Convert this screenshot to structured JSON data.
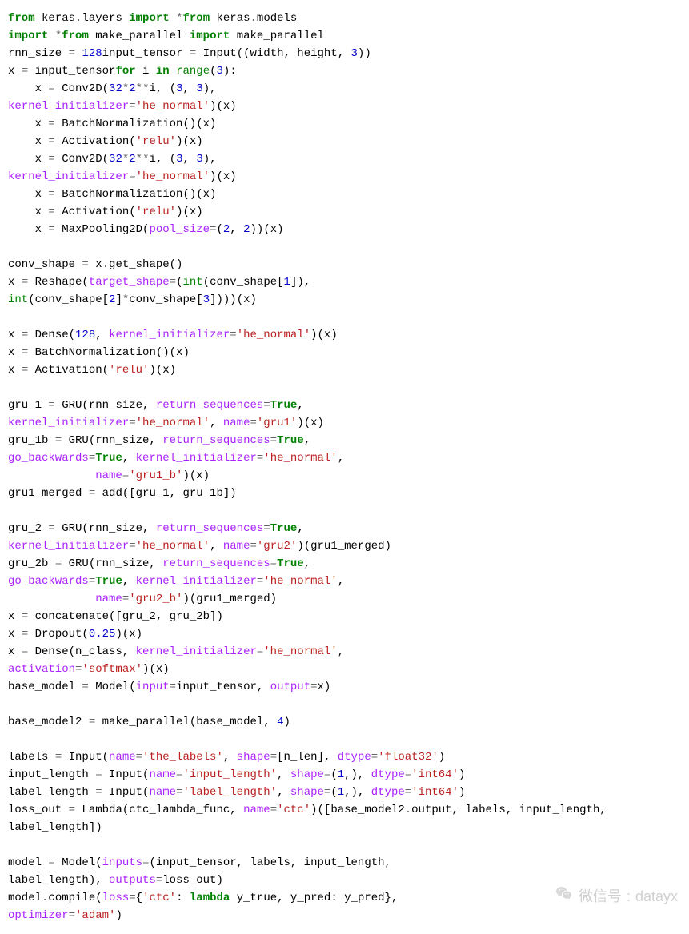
{
  "lines": [
    [
      {
        "t": "from",
        "c": "kw"
      },
      {
        "t": " keras",
        "c": "nm"
      },
      {
        "t": ".",
        "c": "op"
      },
      {
        "t": "layers ",
        "c": "nm"
      },
      {
        "t": "import",
        "c": "kw"
      },
      {
        "t": " ",
        "c": "nm"
      },
      {
        "t": "*",
        "c": "op"
      },
      {
        "t": "from",
        "c": "kw"
      },
      {
        "t": " keras",
        "c": "nm"
      },
      {
        "t": ".",
        "c": "op"
      },
      {
        "t": "models",
        "c": "nm"
      }
    ],
    [
      {
        "t": "import",
        "c": "kw"
      },
      {
        "t": " ",
        "c": "nm"
      },
      {
        "t": "*",
        "c": "op"
      },
      {
        "t": "from",
        "c": "kw"
      },
      {
        "t": " make_parallel ",
        "c": "nm"
      },
      {
        "t": "import",
        "c": "kw"
      },
      {
        "t": " make_parallel",
        "c": "nm"
      }
    ],
    [
      {
        "t": "rnn_size ",
        "c": "nm"
      },
      {
        "t": "=",
        "c": "op"
      },
      {
        "t": " ",
        "c": "nm"
      },
      {
        "t": "128",
        "c": "num"
      },
      {
        "t": "input_tensor ",
        "c": "nm"
      },
      {
        "t": "=",
        "c": "op"
      },
      {
        "t": " Input((width, height, ",
        "c": "nm"
      },
      {
        "t": "3",
        "c": "num"
      },
      {
        "t": "))",
        "c": "nm"
      }
    ],
    [
      {
        "t": "x ",
        "c": "nm"
      },
      {
        "t": "=",
        "c": "op"
      },
      {
        "t": " input_tensor",
        "c": "nm"
      },
      {
        "t": "for",
        "c": "kw"
      },
      {
        "t": " i ",
        "c": "nm"
      },
      {
        "t": "in",
        "c": "kw"
      },
      {
        "t": " ",
        "c": "nm"
      },
      {
        "t": "range",
        "c": "bi"
      },
      {
        "t": "(",
        "c": "nm"
      },
      {
        "t": "3",
        "c": "num"
      },
      {
        "t": "):",
        "c": "nm"
      }
    ],
    [
      {
        "t": "    x ",
        "c": "nm"
      },
      {
        "t": "=",
        "c": "op"
      },
      {
        "t": " Conv2D(",
        "c": "nm"
      },
      {
        "t": "32",
        "c": "num"
      },
      {
        "t": "*",
        "c": "op"
      },
      {
        "t": "2",
        "c": "num"
      },
      {
        "t": "**",
        "c": "op"
      },
      {
        "t": "i, (",
        "c": "nm"
      },
      {
        "t": "3",
        "c": "num"
      },
      {
        "t": ", ",
        "c": "nm"
      },
      {
        "t": "3",
        "c": "num"
      },
      {
        "t": "),",
        "c": "nm"
      }
    ],
    [
      {
        "t": "kernel_initializer",
        "c": "name"
      },
      {
        "t": "=",
        "c": "op"
      },
      {
        "t": "'he_normal'",
        "c": "str"
      },
      {
        "t": ")(x)",
        "c": "nm"
      }
    ],
    [
      {
        "t": "    x ",
        "c": "nm"
      },
      {
        "t": "=",
        "c": "op"
      },
      {
        "t": " BatchNormalization()(x)",
        "c": "nm"
      }
    ],
    [
      {
        "t": "    x ",
        "c": "nm"
      },
      {
        "t": "=",
        "c": "op"
      },
      {
        "t": " Activation(",
        "c": "nm"
      },
      {
        "t": "'relu'",
        "c": "str"
      },
      {
        "t": ")(x)",
        "c": "nm"
      }
    ],
    [
      {
        "t": "    x ",
        "c": "nm"
      },
      {
        "t": "=",
        "c": "op"
      },
      {
        "t": " Conv2D(",
        "c": "nm"
      },
      {
        "t": "32",
        "c": "num"
      },
      {
        "t": "*",
        "c": "op"
      },
      {
        "t": "2",
        "c": "num"
      },
      {
        "t": "**",
        "c": "op"
      },
      {
        "t": "i, (",
        "c": "nm"
      },
      {
        "t": "3",
        "c": "num"
      },
      {
        "t": ", ",
        "c": "nm"
      },
      {
        "t": "3",
        "c": "num"
      },
      {
        "t": "),",
        "c": "nm"
      }
    ],
    [
      {
        "t": "kernel_initializer",
        "c": "name"
      },
      {
        "t": "=",
        "c": "op"
      },
      {
        "t": "'he_normal'",
        "c": "str"
      },
      {
        "t": ")(x)",
        "c": "nm"
      }
    ],
    [
      {
        "t": "    x ",
        "c": "nm"
      },
      {
        "t": "=",
        "c": "op"
      },
      {
        "t": " BatchNormalization()(x)",
        "c": "nm"
      }
    ],
    [
      {
        "t": "    x ",
        "c": "nm"
      },
      {
        "t": "=",
        "c": "op"
      },
      {
        "t": " Activation(",
        "c": "nm"
      },
      {
        "t": "'relu'",
        "c": "str"
      },
      {
        "t": ")(x)",
        "c": "nm"
      }
    ],
    [
      {
        "t": "    x ",
        "c": "nm"
      },
      {
        "t": "=",
        "c": "op"
      },
      {
        "t": " MaxPooling2D(",
        "c": "nm"
      },
      {
        "t": "pool_size",
        "c": "name"
      },
      {
        "t": "=",
        "c": "op"
      },
      {
        "t": "(",
        "c": "nm"
      },
      {
        "t": "2",
        "c": "num"
      },
      {
        "t": ", ",
        "c": "nm"
      },
      {
        "t": "2",
        "c": "num"
      },
      {
        "t": "))(x)",
        "c": "nm"
      }
    ],
    [
      {
        "t": "",
        "c": "nm"
      }
    ],
    [
      {
        "t": "conv_shape ",
        "c": "nm"
      },
      {
        "t": "=",
        "c": "op"
      },
      {
        "t": " x",
        "c": "nm"
      },
      {
        "t": ".",
        "c": "op"
      },
      {
        "t": "get_shape()",
        "c": "nm"
      }
    ],
    [
      {
        "t": "x ",
        "c": "nm"
      },
      {
        "t": "=",
        "c": "op"
      },
      {
        "t": " Reshape(",
        "c": "nm"
      },
      {
        "t": "target_shape",
        "c": "name"
      },
      {
        "t": "=",
        "c": "op"
      },
      {
        "t": "(",
        "c": "nm"
      },
      {
        "t": "int",
        "c": "bi"
      },
      {
        "t": "(conv_shape[",
        "c": "nm"
      },
      {
        "t": "1",
        "c": "num"
      },
      {
        "t": "]),",
        "c": "nm"
      }
    ],
    [
      {
        "t": "int",
        "c": "bi"
      },
      {
        "t": "(conv_shape[",
        "c": "nm"
      },
      {
        "t": "2",
        "c": "num"
      },
      {
        "t": "]",
        "c": "nm"
      },
      {
        "t": "*",
        "c": "op"
      },
      {
        "t": "conv_shape[",
        "c": "nm"
      },
      {
        "t": "3",
        "c": "num"
      },
      {
        "t": "])))(x)",
        "c": "nm"
      }
    ],
    [
      {
        "t": "",
        "c": "nm"
      }
    ],
    [
      {
        "t": "x ",
        "c": "nm"
      },
      {
        "t": "=",
        "c": "op"
      },
      {
        "t": " Dense(",
        "c": "nm"
      },
      {
        "t": "128",
        "c": "num"
      },
      {
        "t": ", ",
        "c": "nm"
      },
      {
        "t": "kernel_initializer",
        "c": "name"
      },
      {
        "t": "=",
        "c": "op"
      },
      {
        "t": "'he_normal'",
        "c": "str"
      },
      {
        "t": ")(x)",
        "c": "nm"
      }
    ],
    [
      {
        "t": "x ",
        "c": "nm"
      },
      {
        "t": "=",
        "c": "op"
      },
      {
        "t": " BatchNormalization()(x)",
        "c": "nm"
      }
    ],
    [
      {
        "t": "x ",
        "c": "nm"
      },
      {
        "t": "=",
        "c": "op"
      },
      {
        "t": " Activation(",
        "c": "nm"
      },
      {
        "t": "'relu'",
        "c": "str"
      },
      {
        "t": ")(x)",
        "c": "nm"
      }
    ],
    [
      {
        "t": "",
        "c": "nm"
      }
    ],
    [
      {
        "t": "gru_1 ",
        "c": "nm"
      },
      {
        "t": "=",
        "c": "op"
      },
      {
        "t": " GRU(rnn_size, ",
        "c": "nm"
      },
      {
        "t": "return_sequences",
        "c": "name"
      },
      {
        "t": "=",
        "c": "op"
      },
      {
        "t": "True",
        "c": "kw"
      },
      {
        "t": ",",
        "c": "nm"
      }
    ],
    [
      {
        "t": "kernel_initializer",
        "c": "name"
      },
      {
        "t": "=",
        "c": "op"
      },
      {
        "t": "'he_normal'",
        "c": "str"
      },
      {
        "t": ", ",
        "c": "nm"
      },
      {
        "t": "name",
        "c": "name"
      },
      {
        "t": "=",
        "c": "op"
      },
      {
        "t": "'gru1'",
        "c": "str"
      },
      {
        "t": ")(x)",
        "c": "nm"
      }
    ],
    [
      {
        "t": "gru_1b ",
        "c": "nm"
      },
      {
        "t": "=",
        "c": "op"
      },
      {
        "t": " GRU(rnn_size, ",
        "c": "nm"
      },
      {
        "t": "return_sequences",
        "c": "name"
      },
      {
        "t": "=",
        "c": "op"
      },
      {
        "t": "True",
        "c": "kw"
      },
      {
        "t": ",",
        "c": "nm"
      }
    ],
    [
      {
        "t": "go_backwards",
        "c": "name"
      },
      {
        "t": "=",
        "c": "op"
      },
      {
        "t": "True",
        "c": "kw"
      },
      {
        "t": ", ",
        "c": "nm"
      },
      {
        "t": "kernel_initializer",
        "c": "name"
      },
      {
        "t": "=",
        "c": "op"
      },
      {
        "t": "'he_normal'",
        "c": "str"
      },
      {
        "t": ",",
        "c": "nm"
      }
    ],
    [
      {
        "t": "             ",
        "c": "nm"
      },
      {
        "t": "name",
        "c": "name"
      },
      {
        "t": "=",
        "c": "op"
      },
      {
        "t": "'gru1_b'",
        "c": "str"
      },
      {
        "t": ")(x)",
        "c": "nm"
      }
    ],
    [
      {
        "t": "gru1_merged ",
        "c": "nm"
      },
      {
        "t": "=",
        "c": "op"
      },
      {
        "t": " add([gru_1, gru_1b])",
        "c": "nm"
      }
    ],
    [
      {
        "t": "",
        "c": "nm"
      }
    ],
    [
      {
        "t": "gru_2 ",
        "c": "nm"
      },
      {
        "t": "=",
        "c": "op"
      },
      {
        "t": " GRU(rnn_size, ",
        "c": "nm"
      },
      {
        "t": "return_sequences",
        "c": "name"
      },
      {
        "t": "=",
        "c": "op"
      },
      {
        "t": "True",
        "c": "kw"
      },
      {
        "t": ",",
        "c": "nm"
      }
    ],
    [
      {
        "t": "kernel_initializer",
        "c": "name"
      },
      {
        "t": "=",
        "c": "op"
      },
      {
        "t": "'he_normal'",
        "c": "str"
      },
      {
        "t": ", ",
        "c": "nm"
      },
      {
        "t": "name",
        "c": "name"
      },
      {
        "t": "=",
        "c": "op"
      },
      {
        "t": "'gru2'",
        "c": "str"
      },
      {
        "t": ")(gru1_merged)",
        "c": "nm"
      }
    ],
    [
      {
        "t": "gru_2b ",
        "c": "nm"
      },
      {
        "t": "=",
        "c": "op"
      },
      {
        "t": " GRU(rnn_size, ",
        "c": "nm"
      },
      {
        "t": "return_sequences",
        "c": "name"
      },
      {
        "t": "=",
        "c": "op"
      },
      {
        "t": "True",
        "c": "kw"
      },
      {
        "t": ",",
        "c": "nm"
      }
    ],
    [
      {
        "t": "go_backwards",
        "c": "name"
      },
      {
        "t": "=",
        "c": "op"
      },
      {
        "t": "True",
        "c": "kw"
      },
      {
        "t": ", ",
        "c": "nm"
      },
      {
        "t": "kernel_initializer",
        "c": "name"
      },
      {
        "t": "=",
        "c": "op"
      },
      {
        "t": "'he_normal'",
        "c": "str"
      },
      {
        "t": ",",
        "c": "nm"
      }
    ],
    [
      {
        "t": "             ",
        "c": "nm"
      },
      {
        "t": "name",
        "c": "name"
      },
      {
        "t": "=",
        "c": "op"
      },
      {
        "t": "'gru2_b'",
        "c": "str"
      },
      {
        "t": ")(gru1_merged)",
        "c": "nm"
      }
    ],
    [
      {
        "t": "x ",
        "c": "nm"
      },
      {
        "t": "=",
        "c": "op"
      },
      {
        "t": " concatenate([gru_2, gru_2b])",
        "c": "nm"
      }
    ],
    [
      {
        "t": "x ",
        "c": "nm"
      },
      {
        "t": "=",
        "c": "op"
      },
      {
        "t": " Dropout(",
        "c": "nm"
      },
      {
        "t": "0.25",
        "c": "num"
      },
      {
        "t": ")(x)",
        "c": "nm"
      }
    ],
    [
      {
        "t": "x ",
        "c": "nm"
      },
      {
        "t": "=",
        "c": "op"
      },
      {
        "t": " Dense(n_class, ",
        "c": "nm"
      },
      {
        "t": "kernel_initializer",
        "c": "name"
      },
      {
        "t": "=",
        "c": "op"
      },
      {
        "t": "'he_normal'",
        "c": "str"
      },
      {
        "t": ",",
        "c": "nm"
      }
    ],
    [
      {
        "t": "activation",
        "c": "name"
      },
      {
        "t": "=",
        "c": "op"
      },
      {
        "t": "'softmax'",
        "c": "str"
      },
      {
        "t": ")(x)",
        "c": "nm"
      }
    ],
    [
      {
        "t": "base_model ",
        "c": "nm"
      },
      {
        "t": "=",
        "c": "op"
      },
      {
        "t": " Model(",
        "c": "nm"
      },
      {
        "t": "input",
        "c": "name"
      },
      {
        "t": "=",
        "c": "op"
      },
      {
        "t": "input_tensor, ",
        "c": "nm"
      },
      {
        "t": "output",
        "c": "name"
      },
      {
        "t": "=",
        "c": "op"
      },
      {
        "t": "x)",
        "c": "nm"
      }
    ],
    [
      {
        "t": "",
        "c": "nm"
      }
    ],
    [
      {
        "t": "base_model2 ",
        "c": "nm"
      },
      {
        "t": "=",
        "c": "op"
      },
      {
        "t": " make_parallel(base_model, ",
        "c": "nm"
      },
      {
        "t": "4",
        "c": "num"
      },
      {
        "t": ")",
        "c": "nm"
      }
    ],
    [
      {
        "t": "",
        "c": "nm"
      }
    ],
    [
      {
        "t": "labels ",
        "c": "nm"
      },
      {
        "t": "=",
        "c": "op"
      },
      {
        "t": " Input(",
        "c": "nm"
      },
      {
        "t": "name",
        "c": "name"
      },
      {
        "t": "=",
        "c": "op"
      },
      {
        "t": "'the_labels'",
        "c": "str"
      },
      {
        "t": ", ",
        "c": "nm"
      },
      {
        "t": "shape",
        "c": "name"
      },
      {
        "t": "=",
        "c": "op"
      },
      {
        "t": "[n_len], ",
        "c": "nm"
      },
      {
        "t": "dtype",
        "c": "name"
      },
      {
        "t": "=",
        "c": "op"
      },
      {
        "t": "'float32'",
        "c": "str"
      },
      {
        "t": ")",
        "c": "nm"
      }
    ],
    [
      {
        "t": "input_length ",
        "c": "nm"
      },
      {
        "t": "=",
        "c": "op"
      },
      {
        "t": " Input(",
        "c": "nm"
      },
      {
        "t": "name",
        "c": "name"
      },
      {
        "t": "=",
        "c": "op"
      },
      {
        "t": "'input_length'",
        "c": "str"
      },
      {
        "t": ", ",
        "c": "nm"
      },
      {
        "t": "shape",
        "c": "name"
      },
      {
        "t": "=",
        "c": "op"
      },
      {
        "t": "(",
        "c": "nm"
      },
      {
        "t": "1",
        "c": "num"
      },
      {
        "t": ",), ",
        "c": "nm"
      },
      {
        "t": "dtype",
        "c": "name"
      },
      {
        "t": "=",
        "c": "op"
      },
      {
        "t": "'int64'",
        "c": "str"
      },
      {
        "t": ")",
        "c": "nm"
      }
    ],
    [
      {
        "t": "label_length ",
        "c": "nm"
      },
      {
        "t": "=",
        "c": "op"
      },
      {
        "t": " Input(",
        "c": "nm"
      },
      {
        "t": "name",
        "c": "name"
      },
      {
        "t": "=",
        "c": "op"
      },
      {
        "t": "'label_length'",
        "c": "str"
      },
      {
        "t": ", ",
        "c": "nm"
      },
      {
        "t": "shape",
        "c": "name"
      },
      {
        "t": "=",
        "c": "op"
      },
      {
        "t": "(",
        "c": "nm"
      },
      {
        "t": "1",
        "c": "num"
      },
      {
        "t": ",), ",
        "c": "nm"
      },
      {
        "t": "dtype",
        "c": "name"
      },
      {
        "t": "=",
        "c": "op"
      },
      {
        "t": "'int64'",
        "c": "str"
      },
      {
        "t": ")",
        "c": "nm"
      }
    ],
    [
      {
        "t": "loss_out ",
        "c": "nm"
      },
      {
        "t": "=",
        "c": "op"
      },
      {
        "t": " Lambda(ctc_lambda_func, ",
        "c": "nm"
      },
      {
        "t": "name",
        "c": "name"
      },
      {
        "t": "=",
        "c": "op"
      },
      {
        "t": "'ctc'",
        "c": "str"
      },
      {
        "t": ")([base_model2",
        "c": "nm"
      },
      {
        "t": ".",
        "c": "op"
      },
      {
        "t": "output, labels, input_length, label_length])",
        "c": "nm"
      }
    ],
    [
      {
        "t": "",
        "c": "nm"
      }
    ],
    [
      {
        "t": "model ",
        "c": "nm"
      },
      {
        "t": "=",
        "c": "op"
      },
      {
        "t": " Model(",
        "c": "nm"
      },
      {
        "t": "inputs",
        "c": "name"
      },
      {
        "t": "=",
        "c": "op"
      },
      {
        "t": "(input_tensor, labels, input_length,",
        "c": "nm"
      }
    ],
    [
      {
        "t": "label_length), ",
        "c": "nm"
      },
      {
        "t": "outputs",
        "c": "name"
      },
      {
        "t": "=",
        "c": "op"
      },
      {
        "t": "loss_out)",
        "c": "nm"
      }
    ],
    [
      {
        "t": "model",
        "c": "nm"
      },
      {
        "t": ".",
        "c": "op"
      },
      {
        "t": "compile(",
        "c": "nm"
      },
      {
        "t": "loss",
        "c": "name"
      },
      {
        "t": "=",
        "c": "op"
      },
      {
        "t": "{",
        "c": "nm"
      },
      {
        "t": "'ctc'",
        "c": "str"
      },
      {
        "t": ": ",
        "c": "nm"
      },
      {
        "t": "lambda",
        "c": "kw"
      },
      {
        "t": " y_true, y_pred: y_pred},",
        "c": "nm"
      }
    ],
    [
      {
        "t": "optimizer",
        "c": "name"
      },
      {
        "t": "=",
        "c": "op"
      },
      {
        "t": "'adam'",
        "c": "str"
      },
      {
        "t": ")",
        "c": "nm"
      }
    ]
  ],
  "watermark": {
    "label": "微信号",
    "value": "datayx"
  }
}
